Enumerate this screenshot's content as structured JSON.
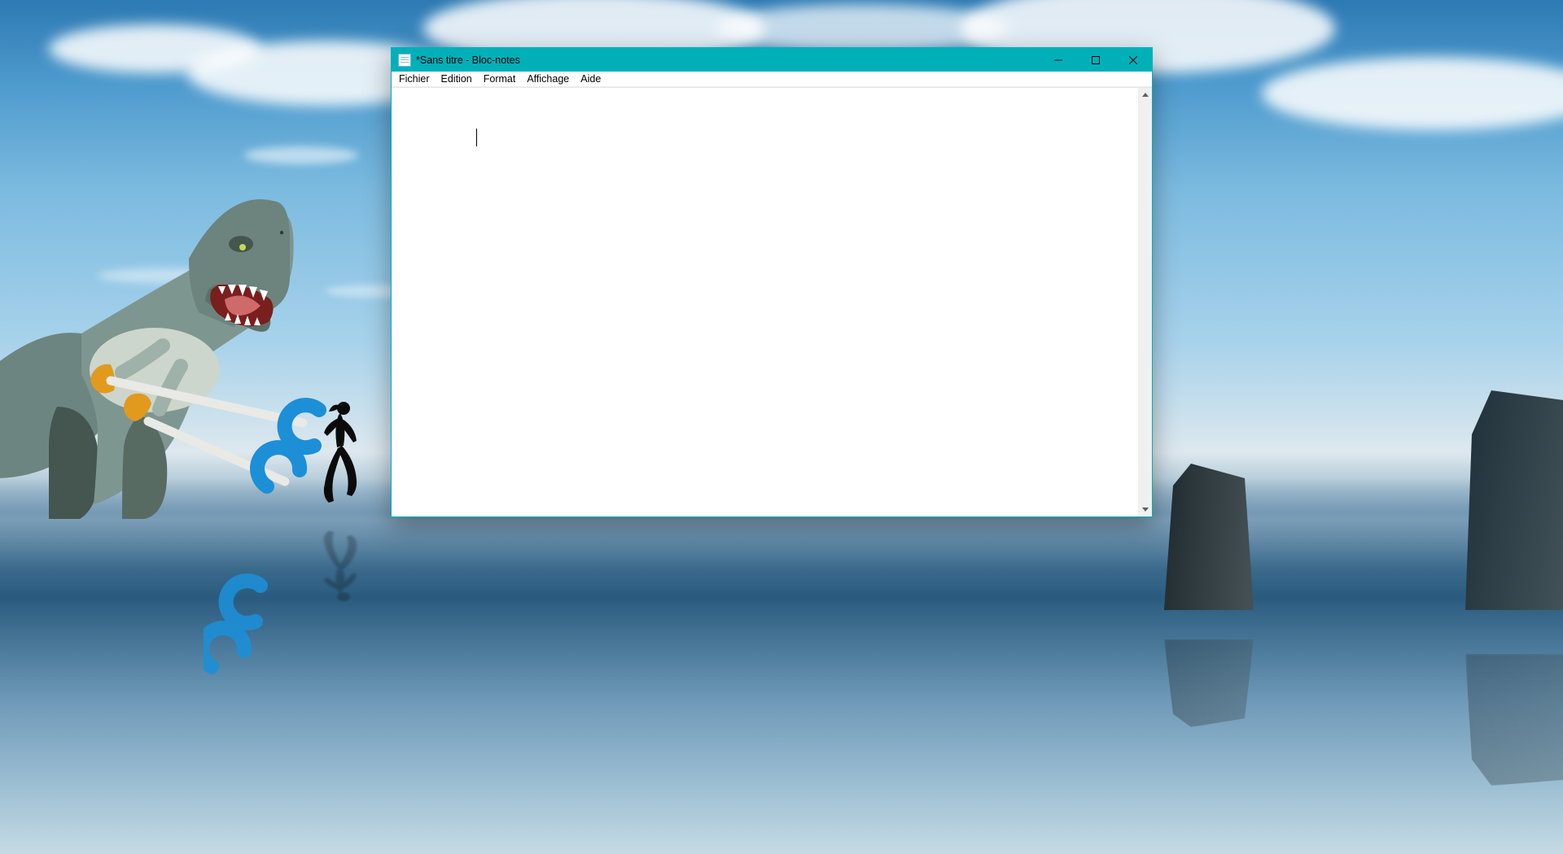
{
  "window": {
    "title": "*Sans titre - Bloc-notes",
    "accent_color": "#00b0b9",
    "controls": {
      "minimize": "Réduire",
      "maximize": "Agrandir",
      "close": "Fermer"
    }
  },
  "menu": {
    "items": [
      "Fichier",
      "Edition",
      "Format",
      "Affichage",
      "Aide"
    ]
  },
  "editor": {
    "content": ""
  },
  "desktop": {
    "description": "Beach scene with clouds, sea stacks and a person jogging; cartoon T-Rex with long reacher-grabber arms chasing the runner"
  }
}
